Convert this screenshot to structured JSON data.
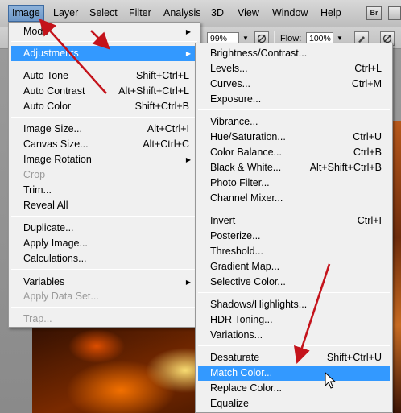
{
  "menubar": {
    "items": [
      {
        "label": "Image",
        "active": true
      },
      {
        "label": "Layer"
      },
      {
        "label": "Select"
      },
      {
        "label": "Filter"
      },
      {
        "label": "Analysis"
      },
      {
        "label": "3D"
      },
      {
        "label": "View"
      },
      {
        "label": "Window"
      },
      {
        "label": "Help"
      }
    ],
    "bridge_label": "Br"
  },
  "options": {
    "opacity_value": "99%",
    "flow_label": "Flow:",
    "flow_value": "100%"
  },
  "image_menu": {
    "items": [
      {
        "label": "Mode",
        "submenu": true
      },
      {
        "label": "Adjustments",
        "submenu": true
      },
      {
        "label": "Auto Tone",
        "shortcut": "Shift+Ctrl+L"
      },
      {
        "label": "Auto Contrast",
        "shortcut": "Alt+Shift+Ctrl+L"
      },
      {
        "label": "Auto Color",
        "shortcut": "Shift+Ctrl+B"
      },
      {
        "label": "Image Size...",
        "shortcut": "Alt+Ctrl+I"
      },
      {
        "label": "Canvas Size...",
        "shortcut": "Alt+Ctrl+C"
      },
      {
        "label": "Image Rotation",
        "submenu": true
      },
      {
        "label": "Crop",
        "disabled": true
      },
      {
        "label": "Trim..."
      },
      {
        "label": "Reveal All"
      },
      {
        "label": "Duplicate..."
      },
      {
        "label": "Apply Image..."
      },
      {
        "label": "Calculations..."
      },
      {
        "label": "Variables",
        "submenu": true
      },
      {
        "label": "Apply Data Set...",
        "disabled": true
      },
      {
        "label": "Trap...",
        "disabled": true
      }
    ]
  },
  "adjust_menu": {
    "items": [
      {
        "label": "Brightness/Contrast..."
      },
      {
        "label": "Levels...",
        "shortcut": "Ctrl+L"
      },
      {
        "label": "Curves...",
        "shortcut": "Ctrl+M"
      },
      {
        "label": "Exposure..."
      },
      {
        "label": "Vibrance..."
      },
      {
        "label": "Hue/Saturation...",
        "shortcut": "Ctrl+U"
      },
      {
        "label": "Color Balance...",
        "shortcut": "Ctrl+B"
      },
      {
        "label": "Black & White...",
        "shortcut": "Alt+Shift+Ctrl+B"
      },
      {
        "label": "Photo Filter..."
      },
      {
        "label": "Channel Mixer..."
      },
      {
        "label": "Invert",
        "shortcut": "Ctrl+I"
      },
      {
        "label": "Posterize..."
      },
      {
        "label": "Threshold..."
      },
      {
        "label": "Gradient Map..."
      },
      {
        "label": "Selective Color..."
      },
      {
        "label": "Shadows/Highlights..."
      },
      {
        "label": "HDR Toning..."
      },
      {
        "label": "Variations..."
      },
      {
        "label": "Desaturate",
        "shortcut": "Shift+Ctrl+U"
      },
      {
        "label": "Match Color...",
        "highlighted": true
      },
      {
        "label": "Replace Color..."
      },
      {
        "label": "Equalize"
      }
    ]
  },
  "colors": {
    "highlight": "#3399ff",
    "annotation_arrow": "#c4131b"
  }
}
